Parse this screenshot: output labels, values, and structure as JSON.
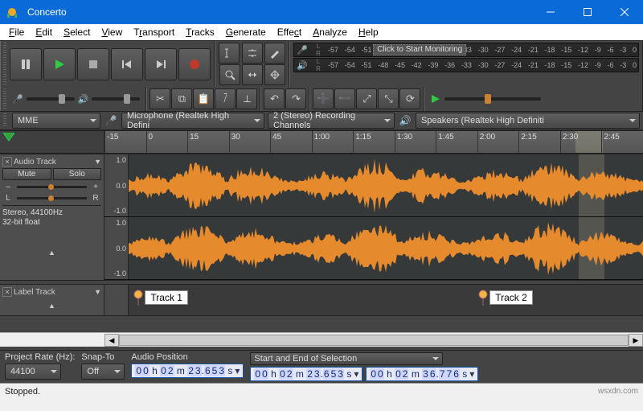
{
  "window": {
    "title": "Concerto"
  },
  "menu": [
    "File",
    "Edit",
    "Select",
    "View",
    "Transport",
    "Tracks",
    "Generate",
    "Effect",
    "Analyze",
    "Help"
  ],
  "meter": {
    "ticks": [
      "-57",
      "-54",
      "-51",
      "-48",
      "-45",
      "-42",
      "-39",
      "-36",
      "-33",
      "-30",
      "-27",
      "-24",
      "-21",
      "-18",
      "-15",
      "-12",
      "-9",
      "-6",
      "-3",
      "0"
    ],
    "rec_tooltip": "Click to Start Monitoring"
  },
  "mix_slider": {
    "left_label": "L",
    "right_label": "R"
  },
  "devices": {
    "host": "MME",
    "input": "Microphone (Realtek High Defini",
    "channels": "2 (Stereo) Recording Channels",
    "output": "Speakers (Realtek High Definiti"
  },
  "timeline": {
    "labels": [
      "-15",
      "0",
      "15",
      "30",
      "45",
      "1:00",
      "1:15",
      "1:30",
      "1:45",
      "2:00",
      "2:15",
      "2:30",
      "2:45"
    ],
    "sel_start_pct": 87.5,
    "sel_end_pct": 92.5
  },
  "tracks": {
    "audio": {
      "name": "Audio Track",
      "mute": "Mute",
      "solo": "Solo",
      "info1": "Stereo, 44100Hz",
      "info2": "32-bit float",
      "scale": [
        "1.0",
        "0.0",
        "-1.0"
      ]
    },
    "label": {
      "name": "Label Track",
      "labels": [
        {
          "text": "Track 1",
          "pos_pct": 1
        },
        {
          "text": "Track 2",
          "pos_pct": 68
        }
      ]
    }
  },
  "selection": {
    "project_rate_label": "Project Rate (Hz):",
    "project_rate": "44100",
    "snap_label": "Snap-To",
    "snap_value": "Off",
    "audio_pos_label": "Audio Position",
    "audio_pos": "00 h 02 m 23.653 s",
    "range_label": "Start and End of Selection",
    "range_start": "00 h 02 m 23.653 s",
    "range_end": "00 h 02 m 36.776 s"
  },
  "status": {
    "text": "Stopped.",
    "watermark": "wsxdn.com"
  }
}
